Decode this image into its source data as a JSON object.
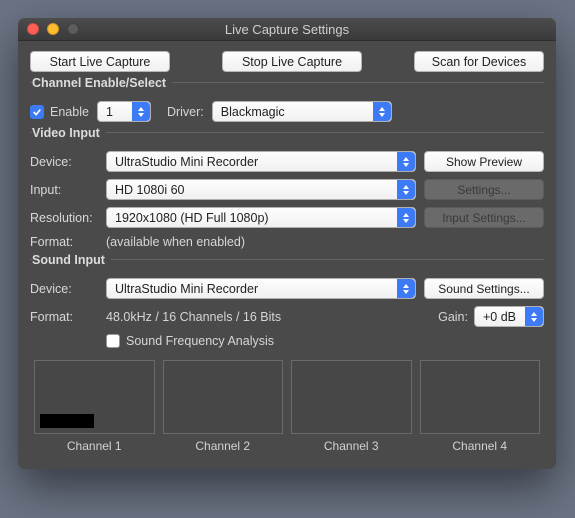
{
  "window": {
    "title": "Live Capture Settings"
  },
  "top": {
    "start": "Start Live Capture",
    "stop": "Stop Live Capture",
    "scan": "Scan for Devices"
  },
  "channel": {
    "title": "Channel Enable/Select",
    "enable_label": "Enable",
    "enable_checked": true,
    "number": "1",
    "driver_label": "Driver:",
    "driver_value": "Blackmagic"
  },
  "video": {
    "title": "Video Input",
    "device_label": "Device:",
    "device_value": "UltraStudio Mini Recorder",
    "show_preview": "Show Preview",
    "input_label": "Input:",
    "input_value": "HD 1080i 60",
    "settings_btn": "Settings...",
    "resolution_label": "Resolution:",
    "resolution_value": "1920x1080 (HD Full 1080p)",
    "input_settings_btn": "Input Settings...",
    "format_label": "Format:",
    "format_value": "(available when enabled)"
  },
  "sound": {
    "title": "Sound Input",
    "device_label": "Device:",
    "device_value": "UltraStudio Mini Recorder",
    "sound_settings": "Sound Settings...",
    "format_label": "Format:",
    "format_value": "48.0kHz / 16 Channels / 16 Bits",
    "gain_label": "Gain:",
    "gain_value": "+0 dB",
    "sfa_label": "Sound Frequency Analysis",
    "sfa_checked": false,
    "channels": [
      "Channel 1",
      "Channel 2",
      "Channel 3",
      "Channel 4"
    ]
  }
}
